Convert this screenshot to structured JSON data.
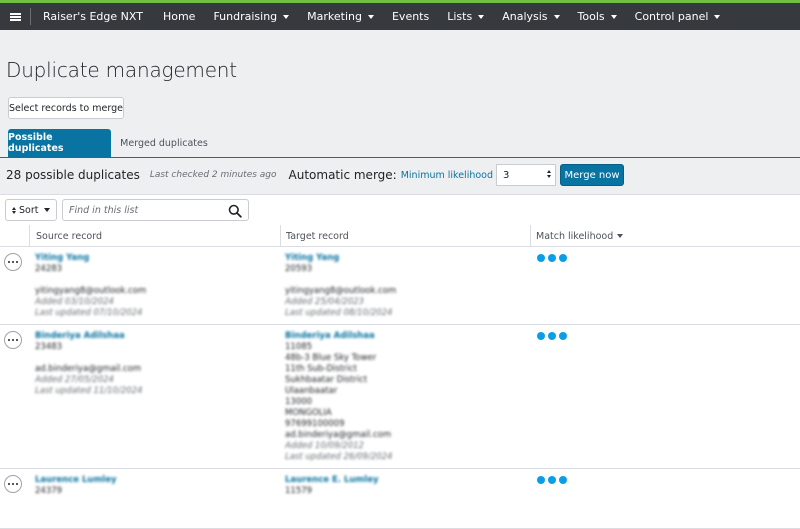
{
  "app": {
    "name": "Raiser's Edge NXT",
    "accent_color": "#71bf44",
    "nav_color": "#36393e",
    "primary_color": "#0974a1"
  },
  "nav": {
    "menu_icon": "hamburger-icon",
    "items": [
      {
        "label": "Home",
        "dropdown": false
      },
      {
        "label": "Fundraising",
        "dropdown": true
      },
      {
        "label": "Marketing",
        "dropdown": true
      },
      {
        "label": "Events",
        "dropdown": false
      },
      {
        "label": "Lists",
        "dropdown": true
      },
      {
        "label": "Analysis",
        "dropdown": true
      },
      {
        "label": "Tools",
        "dropdown": true
      },
      {
        "label": "Control panel",
        "dropdown": true
      }
    ]
  },
  "page": {
    "title": "Duplicate management",
    "select_button": "Select records to merge"
  },
  "tabs": [
    {
      "label": "Possible duplicates",
      "active": true
    },
    {
      "label": "Merged duplicates",
      "active": false
    }
  ],
  "summary": {
    "count": "28 possible duplicates",
    "last_checked": "Last checked 2 minutes ago",
    "automatic_merge": "Automatic merge:",
    "minimum_likelihood": "Minimum likelihood",
    "likelihood_value": "3",
    "merge_button": "Merge now"
  },
  "toolbar": {
    "sort_label": "Sort",
    "search_placeholder": "Find in this list",
    "search_value": ""
  },
  "table": {
    "headers": {
      "source": "Source record",
      "target": "Target record",
      "match": "Match likelihood"
    },
    "rows": [
      {
        "source": {
          "name": "Yiting Yang",
          "id": "24283",
          "email": "yitingyang8@outlook.com",
          "added": "Added 03/10/2024",
          "updated": "Last updated 07/10/2024"
        },
        "target": {
          "name": "Yiting Yang",
          "id": "20593",
          "address": [],
          "email": "yitingyang8@outlook.com",
          "added": "Added 25/04/2023",
          "updated": "Last updated 08/10/2024"
        },
        "match": 3
      },
      {
        "source": {
          "name": "Binderiya Adilshaa",
          "id": "23483",
          "email": "ad.binderiya@gmail.com",
          "added": "Added 27/05/2024",
          "updated": "Last updated 11/10/2024"
        },
        "target": {
          "name": "Binderiya Adilshaa",
          "id": "11085",
          "address": [
            "48b-3 Blue Sky Tower",
            "11th Sub-District",
            "Sukhbaatar District",
            "Ulaanbaatar",
            "13000",
            "MONGOLIA",
            "97699100009"
          ],
          "email": "ad.binderiya@gmail.com",
          "added": "Added 10/09/2012",
          "updated": "Last updated 26/09/2024"
        },
        "match": 3
      },
      {
        "source": {
          "name": "Laurence Lumley",
          "id": "24379",
          "email": "",
          "added": "",
          "updated": ""
        },
        "target": {
          "name": "Laurence E. Lumley",
          "id": "11579",
          "address": [],
          "email": "",
          "added": "",
          "updated": ""
        },
        "match": 3
      }
    ]
  }
}
